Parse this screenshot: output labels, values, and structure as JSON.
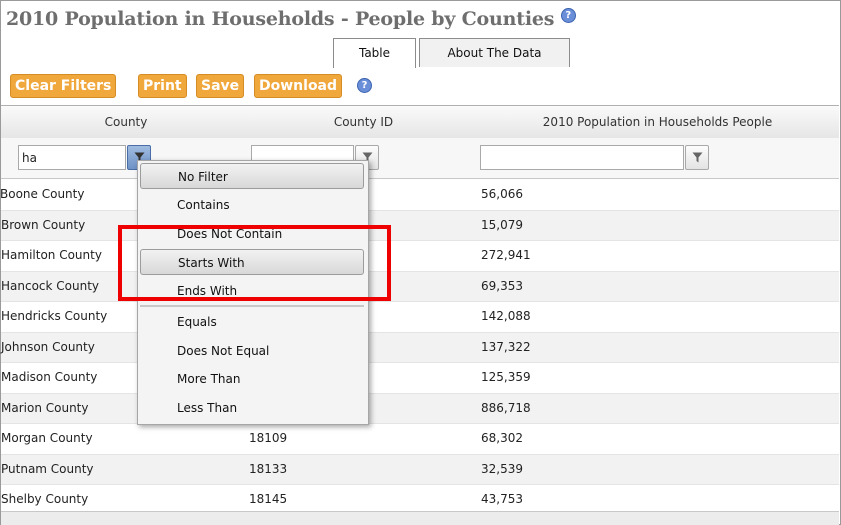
{
  "page": {
    "title": "2010 Population in Households - People by Counties",
    "title_help_icon": "help-icon"
  },
  "tabs": [
    {
      "label": "Table",
      "active": true
    },
    {
      "label": "About The Data",
      "active": false
    }
  ],
  "toolbar": {
    "clear_filters_label": "Clear Filters",
    "print_label": "Print",
    "save_label": "Save",
    "download_label": "Download",
    "help_icon": "help-icon"
  },
  "table": {
    "columns": [
      "County",
      "County ID",
      "2010 Population in Households People"
    ],
    "filters": {
      "county": {
        "value": "ha",
        "placeholder": ""
      },
      "county_id": {
        "value": "",
        "placeholder": ""
      },
      "population": {
        "value": "",
        "placeholder": ""
      }
    },
    "rows": [
      {
        "county": "Boone County",
        "county_id": "",
        "population": "56,066"
      },
      {
        "county": "Brown County",
        "county_id": "",
        "population": "15,079"
      },
      {
        "county": "Hamilton County",
        "county_id": "",
        "population": "272,941"
      },
      {
        "county": "Hancock County",
        "county_id": "",
        "population": "69,353"
      },
      {
        "county": "Hendricks County",
        "county_id": "",
        "population": "142,088"
      },
      {
        "county": "Johnson County",
        "county_id": "",
        "population": "137,322"
      },
      {
        "county": "Madison County",
        "county_id": "",
        "population": "125,359"
      },
      {
        "county": "Marion County",
        "county_id": "",
        "population": "886,718"
      },
      {
        "county": "Morgan County",
        "county_id": "18109",
        "population": "68,302"
      },
      {
        "county": "Putnam County",
        "county_id": "18133",
        "population": "32,539"
      },
      {
        "county": "Shelby County",
        "county_id": "18145",
        "population": "43,753"
      }
    ]
  },
  "filter_menu": {
    "items": [
      "No Filter",
      "Contains",
      "Does Not Contain",
      "Starts With",
      "Ends With",
      "Equals",
      "Does Not Equal",
      "More Than",
      "Less Than"
    ],
    "highlighted": [
      "No Filter",
      "Starts With"
    ]
  },
  "colors": {
    "button_orange": "#f0a73c",
    "highlight_red": "#ee0000",
    "help_blue": "#6a8fd8"
  }
}
